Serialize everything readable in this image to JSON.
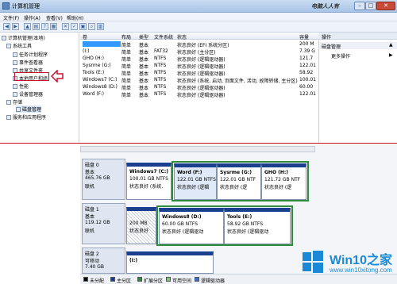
{
  "window": {
    "title": "计算机管理",
    "watermark_top": "电脑人人有"
  },
  "menu": [
    "文件(F)",
    "操作(A)",
    "查看(V)",
    "帮助(H)"
  ],
  "tree": {
    "root": "计算机管理(本地)",
    "system_tools": "系统工具",
    "task_scheduler": "任务计划程序",
    "event_viewer": "事件查看器",
    "shared_folders": "共享文件夹",
    "local_users": "本地用户和组",
    "performance": "性能",
    "device_manager": "设备管理器",
    "storage": "存储",
    "disk_management": "磁盘管理",
    "services_apps": "服务和应用程序"
  },
  "columns": [
    "卷",
    "布局",
    "类型",
    "文件系统",
    "状态",
    "容量"
  ],
  "volumes": [
    {
      "name": "",
      "layout": "简单",
      "type": "基本",
      "fs": "",
      "status": "状态良好 (EFI 系统分区)",
      "size": "200 M"
    },
    {
      "name": "(I:)",
      "layout": "简单",
      "type": "基本",
      "fs": "FAT32",
      "status": "状态良好 (主分区)",
      "size": "7.39 G"
    },
    {
      "name": "GHO (H:)",
      "layout": "简单",
      "type": "基本",
      "fs": "NTFS",
      "status": "状态良好 (逻辑驱动器)",
      "size": "121.7"
    },
    {
      "name": "Sysrme (G:)",
      "layout": "简单",
      "type": "基本",
      "fs": "NTFS",
      "status": "状态良好 (逻辑驱动器)",
      "size": "122.01"
    },
    {
      "name": "Tools (E:)",
      "layout": "简单",
      "type": "基本",
      "fs": "NTFS",
      "status": "状态良好 (逻辑驱动器)",
      "size": "58.92"
    },
    {
      "name": "Windows7 (C:)",
      "layout": "简单",
      "type": "基本",
      "fs": "NTFS",
      "status": "状态良好 (系统, 启动, 页面文件, 活动, 故障转储, 主分区)",
      "size": "100.01"
    },
    {
      "name": "Windows8 (D:)",
      "layout": "简单",
      "type": "基本",
      "fs": "NTFS",
      "status": "状态良好 (逻辑驱动器)",
      "size": "60.00"
    },
    {
      "name": "Word (F:)",
      "layout": "简单",
      "type": "基本",
      "fs": "NTFS",
      "status": "状态良好 (逻辑驱动器)",
      "size": "122.01"
    }
  ],
  "actions": {
    "header": "操作",
    "section": "磁盘管理",
    "more": "更多操作"
  },
  "disks": [
    {
      "label": "磁盘 0",
      "kind": "基本",
      "size": "465.76 GB",
      "state": "联机",
      "partitions": [
        {
          "name": "Windows7 (C:)",
          "size": "100.01 GB NTFS",
          "status": "状态良好 (系统,"
        },
        {
          "name": "Word (F:)",
          "size": "122.01 GB NTFS",
          "status": "状态良好 (逻辑"
        },
        {
          "name": "Sysrme (G:)",
          "size": "122.01 GB NTF",
          "status": "状态良好 (逻"
        },
        {
          "name": "GHO (H:)",
          "size": "121.72 GB NTF",
          "status": "状态良好 (逻"
        }
      ]
    },
    {
      "label": "磁盘 1",
      "kind": "基本",
      "size": "119.12 GB",
      "state": "联机",
      "partitions": [
        {
          "name": "",
          "size": "200 MB",
          "status": "状态良好"
        },
        {
          "name": "Windows8 (D:)",
          "size": "60.00 GB NTFS",
          "status": "状态良好 (逻辑驱动"
        },
        {
          "name": "Tools (E:)",
          "size": "58.92 GB NTFS",
          "status": "状态良好 (逻辑驱动"
        }
      ]
    },
    {
      "label": "磁盘 2",
      "kind": "可移动",
      "size": "7.40 GB",
      "partitions": [
        {
          "name": "(I:)",
          "size": "",
          "status": ""
        }
      ]
    }
  ],
  "legend": [
    "未分配",
    "主分区",
    "扩展分区",
    "可用空间",
    "逻辑驱动器"
  ],
  "legend_colors": [
    "#000000",
    "#1b3f8f",
    "#2e8b3e",
    "#7ec27e",
    "#3a6fd8"
  ],
  "watermark": {
    "brand": "Win10之家",
    "url": "www.win10xitong.com"
  }
}
